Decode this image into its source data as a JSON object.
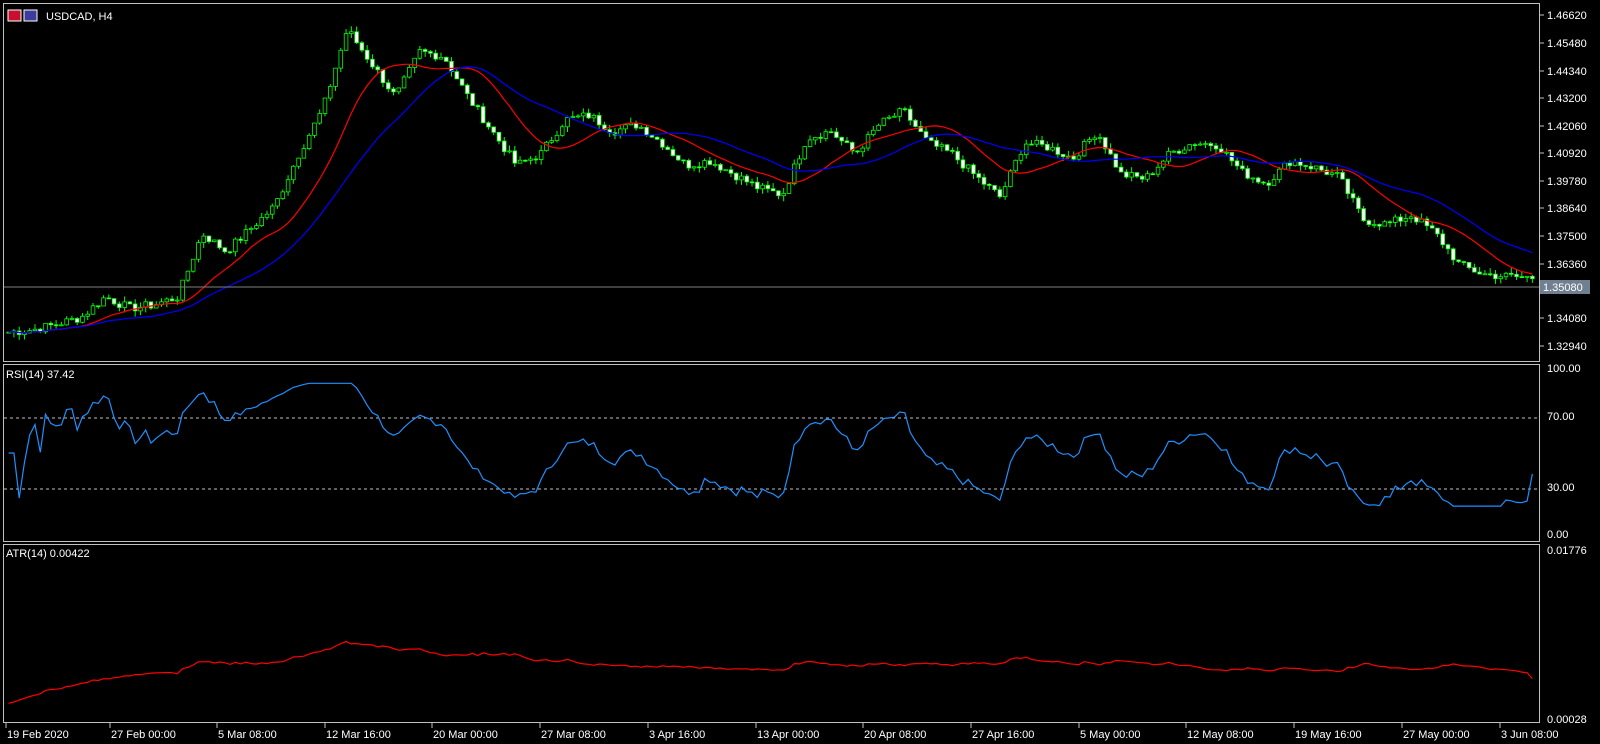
{
  "main_chart": {
    "symbol_label": "USDCAD, H4",
    "price_ticks": [
      "1.46620",
      "1.45480",
      "1.44340",
      "1.43200",
      "1.42060",
      "1.40920",
      "1.39780",
      "1.38640",
      "1.37500",
      "1.36360",
      "1.35080",
      "1.34080",
      "1.32940"
    ],
    "current_price_label": "1.35080",
    "colors": {
      "bull_candle": "#00ff00",
      "ma_fast": "#ff0000",
      "ma_slow": "#0000ff",
      "current_price_line": "#808080",
      "price_badge": "#708090"
    }
  },
  "rsi_panel": {
    "label": "RSI(14) 37.42",
    "ticks": [
      "100.00",
      "70.00",
      "30.00",
      "0.00"
    ],
    "color": "#1e90ff"
  },
  "atr_panel": {
    "label": "ATR(14) 0.00422",
    "ticks": [
      "0.01776",
      "0.00028"
    ],
    "color": "#ff0000"
  },
  "time_axis": {
    "labels": [
      "19 Feb 2020",
      "27 Feb 00:00",
      "5 Mar 08:00",
      "12 Mar 16:00",
      "20 Mar 00:00",
      "27 Mar 08:00",
      "3 Apr 16:00",
      "13 Apr 00:00",
      "20 Apr 08:00",
      "27 Apr 16:00",
      "5 May 00:00",
      "12 May 08:00",
      "19 May 16:00",
      "27 May 00:00",
      "3 Jun 08:00"
    ]
  },
  "chart_data": [
    {
      "type": "candlestick",
      "title": "USDCAD, H4",
      "ylim": [
        1.323,
        1.4662
      ],
      "close_path": [
        [
          "19 Feb 2020",
          1.3265
        ],
        [
          "22 Feb",
          1.3275
        ],
        [
          "25 Feb",
          1.33
        ],
        [
          "27 Feb 00:00",
          1.333
        ],
        [
          "29 Feb",
          1.342
        ],
        [
          "2 Mar",
          1.337
        ],
        [
          "3 Mar",
          1.3385
        ],
        [
          "5 Mar 08:00",
          1.342
        ],
        [
          "6 Mar",
          1.37
        ],
        [
          "8 Mar",
          1.362
        ],
        [
          "10 Mar",
          1.372
        ],
        [
          "12 Mar 16:00",
          1.382
        ],
        [
          "14 Mar",
          1.405
        ],
        [
          "16 Mar",
          1.425
        ],
        [
          "17 Mar",
          1.46
        ],
        [
          "18 Mar",
          1.445
        ],
        [
          "19 Mar",
          1.43
        ],
        [
          "20 Mar 00:00",
          1.45
        ],
        [
          "21 Mar",
          1.448
        ],
        [
          "23 Mar",
          1.43
        ],
        [
          "25 Mar",
          1.415
        ],
        [
          "26 Mar",
          1.4
        ],
        [
          "27 Mar 08:00",
          1.405
        ],
        [
          "29 Mar",
          1.42
        ],
        [
          "31 Mar",
          1.422
        ],
        [
          "1 Apr",
          1.415
        ],
        [
          "3 Apr 16:00",
          1.418
        ],
        [
          "5 Apr",
          1.41
        ],
        [
          "7 Apr",
          1.4
        ],
        [
          "9 Apr",
          1.402
        ],
        [
          "11 Apr",
          1.396
        ],
        [
          "12 Apr",
          1.39
        ],
        [
          "13 Apr 00:00",
          1.387
        ],
        [
          "15 Apr",
          1.412
        ],
        [
          "16 Apr",
          1.415
        ],
        [
          "18 Apr",
          1.405
        ],
        [
          "20 Apr 08:00",
          1.418
        ],
        [
          "21 Apr",
          1.424
        ],
        [
          "23 Apr",
          1.41
        ],
        [
          "25 Apr",
          1.405
        ],
        [
          "27 Apr 16:00",
          1.395
        ],
        [
          "29 Apr",
          1.386
        ],
        [
          "1 May",
          1.41
        ],
        [
          "3 May",
          1.408
        ],
        [
          "5 May 00:00",
          1.403
        ],
        [
          "6 May",
          1.415
        ],
        [
          "8 May",
          1.396
        ],
        [
          "10 May",
          1.394
        ],
        [
          "12 May 08:00",
          1.405
        ],
        [
          "13 May",
          1.41
        ],
        [
          "15 May",
          1.409
        ],
        [
          "17 May",
          1.397
        ],
        [
          "19 May 16:00",
          1.392
        ],
        [
          "20 May",
          1.402
        ],
        [
          "22 May",
          1.399
        ],
        [
          "24 May",
          1.395
        ],
        [
          "25 May",
          1.376
        ],
        [
          "27 May 00:00",
          1.374
        ],
        [
          "29 May",
          1.378
        ],
        [
          "30 May",
          1.37
        ],
        [
          "1 Jun",
          1.356
        ],
        [
          "2 Jun",
          1.352
        ],
        [
          "3 Jun 08:00",
          1.351
        ],
        [
          "4 Jun",
          1.3505
        ]
      ],
      "current_price": 1.3508
    },
    {
      "type": "line",
      "title": "RSI(14) 37.42",
      "ylim": [
        0,
        100
      ],
      "levels": [
        70,
        30
      ],
      "last_value": 37.42
    },
    {
      "type": "line",
      "title": "ATR(14) 0.00422",
      "ylim": [
        0.00028,
        0.01776
      ],
      "last_value": 0.00422
    }
  ]
}
